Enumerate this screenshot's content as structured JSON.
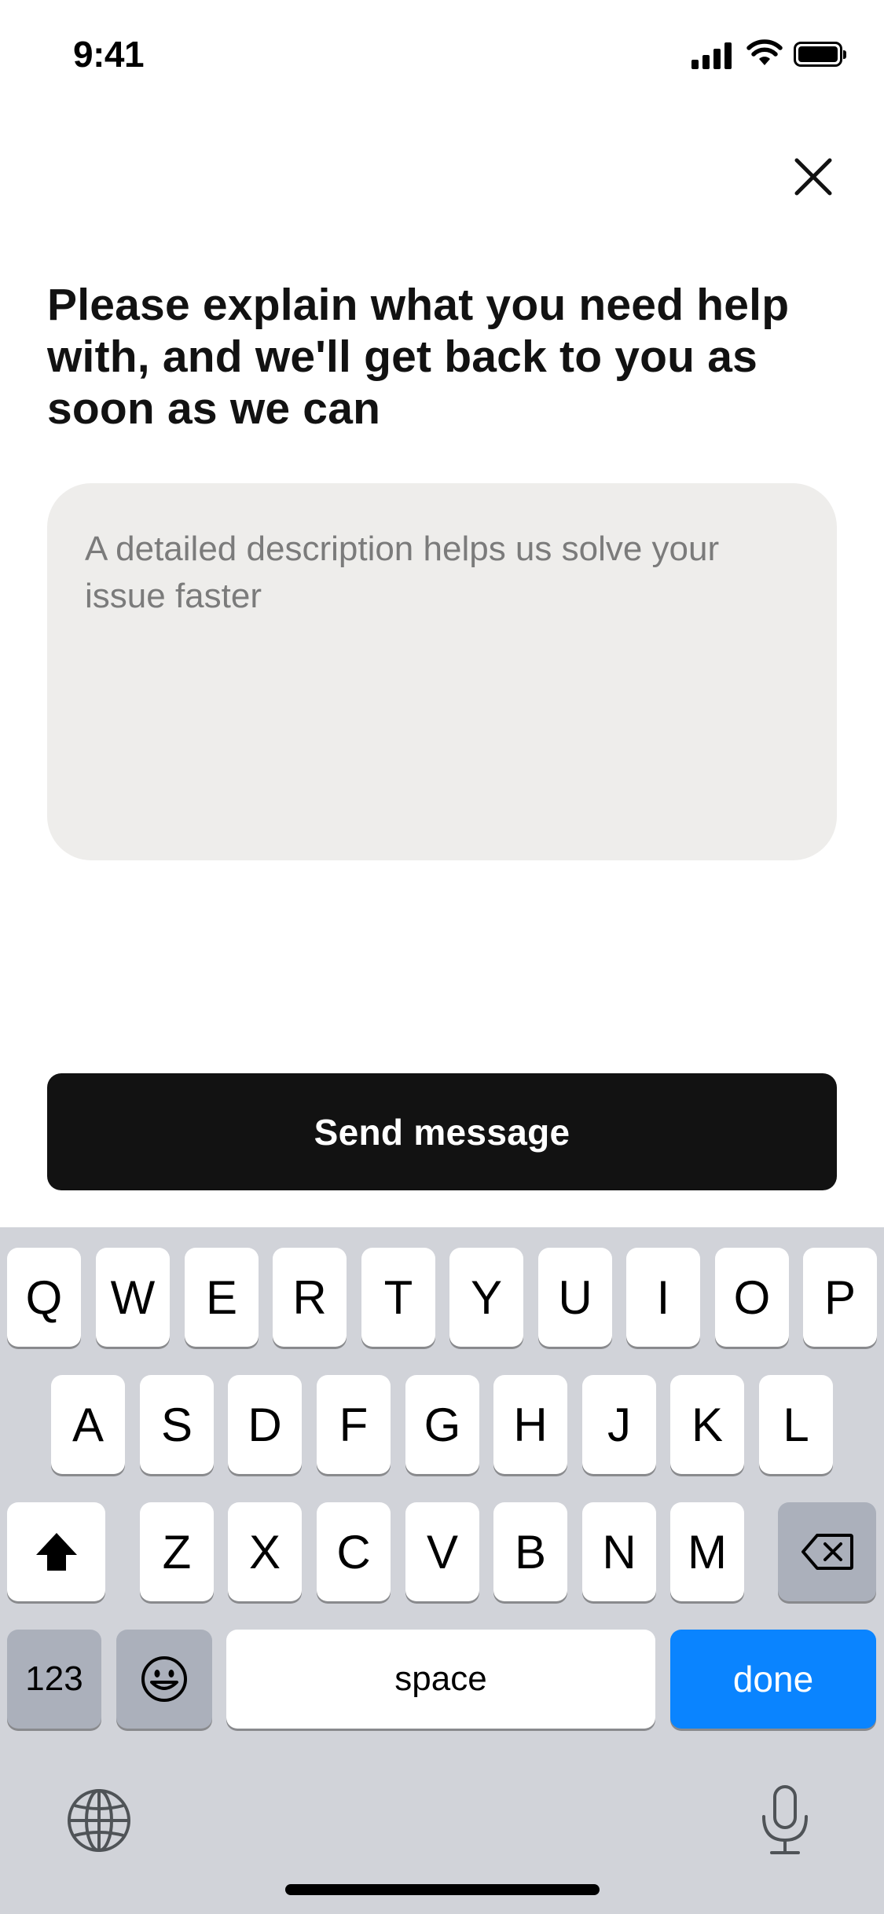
{
  "status_bar": {
    "time": "9:41"
  },
  "title": "Please explain what you need help with, and we'll get back to you as soon as we can",
  "description_field": {
    "value": "",
    "placeholder": "A detailed description helps us solve your issue faster"
  },
  "send_button_label": "Send message",
  "keyboard": {
    "row1": [
      "Q",
      "W",
      "E",
      "R",
      "T",
      "Y",
      "U",
      "I",
      "O",
      "P"
    ],
    "row2": [
      "A",
      "S",
      "D",
      "F",
      "G",
      "H",
      "J",
      "K",
      "L"
    ],
    "row3": [
      "Z",
      "X",
      "C",
      "V",
      "B",
      "N",
      "M"
    ],
    "numbers_label": "123",
    "space_label": "space",
    "done_label": "done"
  },
  "colors": {
    "background": "#ffffff",
    "field_background": "#eeedeb",
    "button_background": "#121212",
    "keyboard_background": "#d1d3d9",
    "done_key": "#0a84ff"
  },
  "icons": [
    "signal-icon",
    "wifi-icon",
    "battery-icon",
    "close-icon",
    "shift-icon",
    "backspace-icon",
    "emoji-icon",
    "globe-icon",
    "microphone-icon"
  ]
}
